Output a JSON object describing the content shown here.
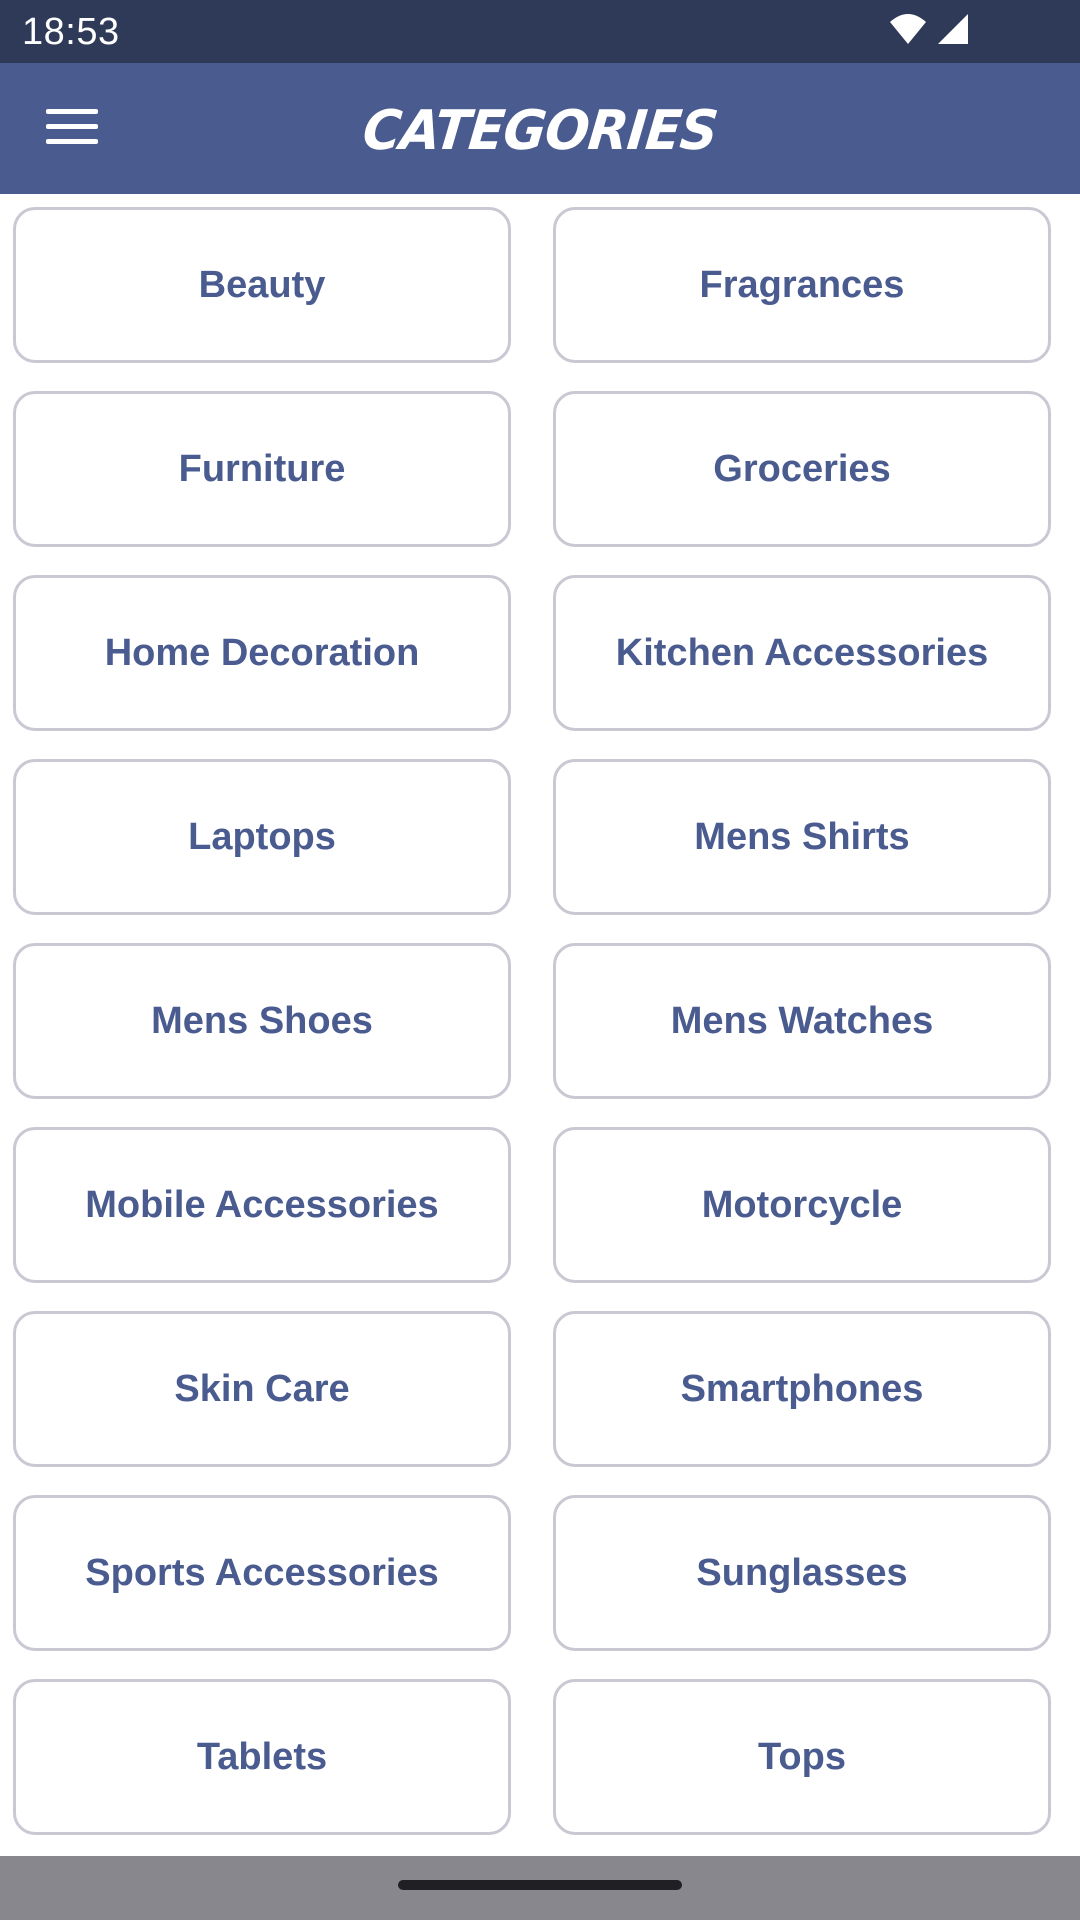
{
  "status_bar": {
    "time": "18:53",
    "icons": [
      "wifi-icon",
      "cellular-signal-icon"
    ]
  },
  "app_bar": {
    "title": "CATEGORIES",
    "menu_icon": "hamburger-menu-icon"
  },
  "colors": {
    "status_bar_bg": "#2f3a59",
    "app_bar_bg": "#4a5b8f",
    "accent_text": "#4a5b8f",
    "card_border": "#c9c9d3",
    "nav_bar_bg": "#87878d"
  },
  "categories": [
    {
      "label": "Beauty"
    },
    {
      "label": "Fragrances"
    },
    {
      "label": "Furniture"
    },
    {
      "label": "Groceries"
    },
    {
      "label": "Home Decoration"
    },
    {
      "label": "Kitchen Accessories"
    },
    {
      "label": "Laptops"
    },
    {
      "label": "Mens Shirts"
    },
    {
      "label": "Mens Shoes"
    },
    {
      "label": "Mens Watches"
    },
    {
      "label": "Mobile Accessories"
    },
    {
      "label": "Motorcycle"
    },
    {
      "label": "Skin Care"
    },
    {
      "label": "Smartphones"
    },
    {
      "label": "Sports Accessories"
    },
    {
      "label": "Sunglasses"
    },
    {
      "label": "Tablets"
    },
    {
      "label": "Tops"
    }
  ]
}
